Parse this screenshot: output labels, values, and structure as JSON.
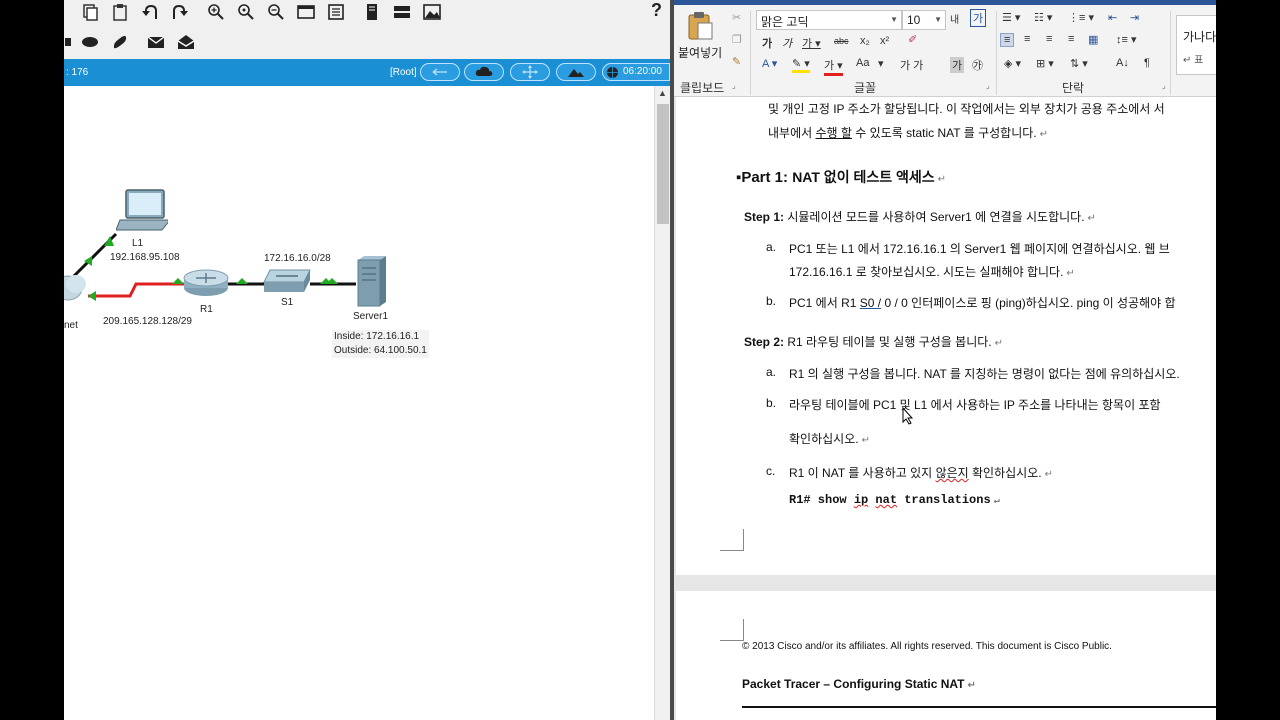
{
  "packet_tracer": {
    "status_counter": ": 176",
    "root_label": "[Root]",
    "clock": "06:20:00",
    "help_symbol": "?",
    "topology": {
      "laptop_label": "L1",
      "laptop_ip": "192.168.95.108",
      "router_label": "R1",
      "switch_label": "S1",
      "server_label": "Server1",
      "internet_label": "net",
      "lan_network": "172.16.16.0/28",
      "wan_network": "209.165.128.128/29",
      "server_inside": "Inside:   172.16.16.1",
      "server_outside": "Outside: 64.100.50.1"
    },
    "colors": {
      "status_bar": "#1a8fd4",
      "link_green": "#22aa22",
      "link_red": "#e02020"
    }
  },
  "word": {
    "ribbon": {
      "paste_label": "붙여넣기",
      "font_name": "맑은 고딕",
      "font_size": "10",
      "clipboard_label": "클립보드",
      "font_label": "글꼴",
      "paragraph_label": "단락",
      "style_preview": "가나다",
      "style_preview2": "↵ 표",
      "bold_btn": "가",
      "italic_btn": "가",
      "strike_btn": "abc",
      "sub_btn": "x₂",
      "sup_btn": "x²",
      "grow_btn": "내",
      "case_btn": "Aa"
    },
    "doc": {
      "line_intro1": "및 개인 고정 IP 주소가 할당됩니다. 이 작업에서는 외부 장치가 공용 주소에서 서",
      "line_intro2_a": "내부에서 ",
      "line_intro2_u": "수행 할",
      "line_intro2_b": " 수 있도록 static NAT 를 구성합니다.",
      "part1_heading_a": "Part 1: ",
      "part1_heading_b": "NAT 없이 테스트 액세스",
      "step1_a": "Step 1: ",
      "step1_b": "시뮬레이션 모드를 사용하여 Server1 에 연결을 시도합니다.",
      "s1a_letter": "a.",
      "s1a_line1": "PC1 또는 L1 에서 172.16.16.1 의 Server1 웹 페이지에 연결하십시오. 웹 브",
      "s1a_line2": "172.16.16.1 로 찾아보십시오. 시도는 실패해야 합니다.",
      "s1b_letter": "b.",
      "s1b_a": "PC1 에서 R1 ",
      "s1b_u": "S0 /",
      "s1b_b": " 0 / 0 인터페이스로 핑 (ping)하십시오. ping 이 성공해야 합",
      "step2_a": "Step 2: ",
      "step2_b": "R1 라우팅 테이블 및 실행 구성을 봅니다.",
      "s2a_letter": "a.",
      "s2a_line": "R1 의 실행 구성을 봅니다. NAT 를 지칭하는 명령이 없다는 점에 유의하십시오.",
      "s2b_letter": "b.",
      "s2b_line1": "라우팅 테이블에 PC1 및 L1 에서 사용하는 IP 주소를 나타내는 항목이 포함",
      "s2b_line2": "확인하십시오.",
      "s2c_letter": "c.",
      "s2c_a": "R1 이 NAT 를 사용하고 있지 ",
      "s2c_u": "않은지",
      "s2c_b": " 확인하십시오.",
      "cmd_a": "R1# show ",
      "cmd_ip": "ip",
      "cmd_sp": " ",
      "cmd_nat": "nat",
      "cmd_b": " translations",
      "para_mark": "↵",
      "copyright": "© 2013 Cisco and/or its affiliates. All rights reserved. This document is Cisco Public.",
      "footer_title": "Packet Tracer – Configuring Static NAT"
    }
  }
}
